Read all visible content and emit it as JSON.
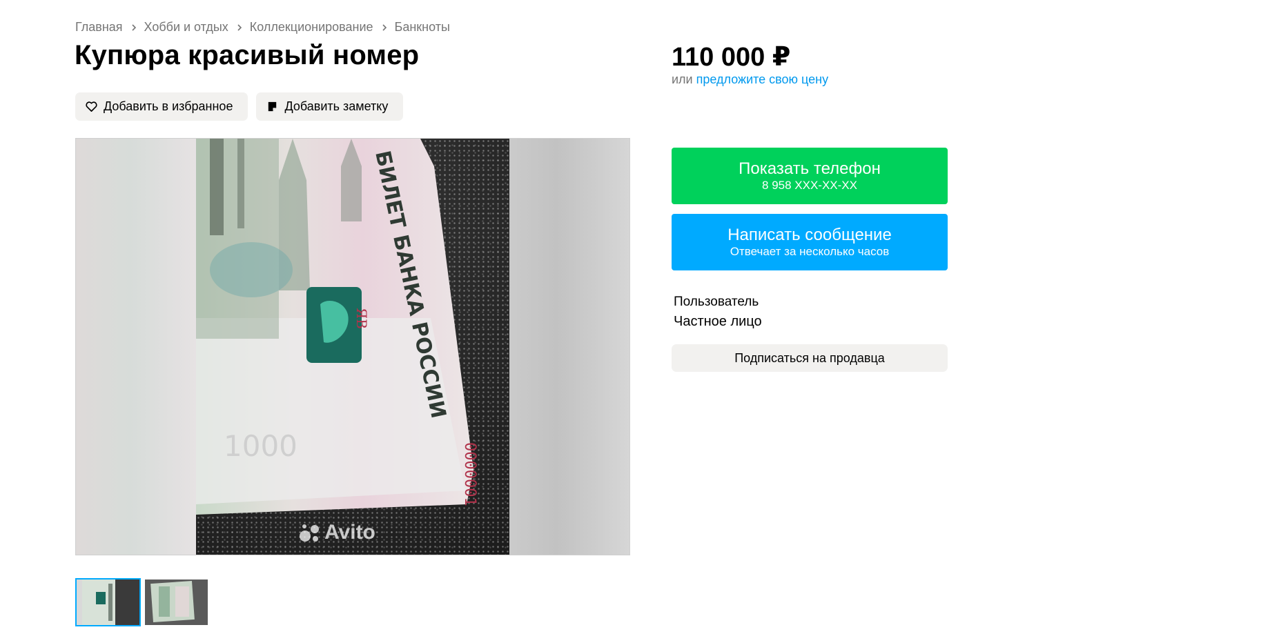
{
  "breadcrumbs": [
    "Главная",
    "Хобби и отдых",
    "Коллекционирование",
    "Банкноты"
  ],
  "listing": {
    "title": "Купюра красивый номер",
    "favorite_label": "Добавить в избранное",
    "note_label": "Добавить заметку",
    "price": "110 000 ₽",
    "offer_prefix": "или",
    "offer_link": "предложите свою цену"
  },
  "photo": {
    "banknote_text": "БИЛЕТ БАНКА РОССИИ",
    "series": "ЯВ",
    "serial_number": "0000001",
    "denomination": "1000",
    "watermark": "Avito"
  },
  "contact": {
    "phone_button": "Показать телефон",
    "phone_masked": "8 958 XXX-XX-XX",
    "message_button": "Написать сообщение",
    "message_sub": "Отвечает за несколько часов"
  },
  "seller": {
    "name": "Пользователь",
    "type": "Частное лицо",
    "subscribe_label": "Подписаться на продавца"
  },
  "colors": {
    "phone_button": "#00d15b",
    "message_button": "#00aaff",
    "link": "#0099ee",
    "pill_bg": "#f2f1ef"
  }
}
